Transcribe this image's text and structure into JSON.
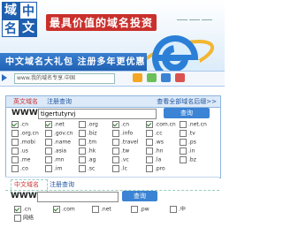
{
  "colors": {
    "accent": "#2c6cc0",
    "brand_red": "#c9302c",
    "panel_border": "#8eb5df"
  },
  "logo": {
    "chars": [
      "域",
      "名",
      "中",
      "文"
    ]
  },
  "banner": {
    "tagline": "最具价值的域名投资",
    "gift_text": "中文域名大礼包  注册多年更优惠"
  },
  "search_strip": {
    "placeholder": "www.我的域名专享.中国"
  },
  "panel": {
    "tab_en": "英文域名",
    "tab_reg": "注册查询",
    "right_link": "查看全部域名后缀>>",
    "www_label": "WWW.",
    "domain_value": "tigertutyrvj",
    "query_button": "查询",
    "extensions": [
      [
        {
          "label": ".cn",
          "checked": true
        },
        {
          "label": ".net",
          "checked": true
        },
        {
          "label": ".org",
          "checked": false
        },
        {
          "label": ".cn",
          "checked": true
        },
        {
          "label": ".com.cn",
          "checked": true
        },
        {
          "label": ".net.cn",
          "checked": false
        }
      ],
      [
        {
          "label": ".org.cn",
          "checked": false
        },
        {
          "label": ".gov.cn",
          "checked": false
        },
        {
          "label": ".biz",
          "checked": false
        },
        {
          "label": ".info",
          "checked": false
        },
        {
          "label": ".cc",
          "checked": false
        },
        {
          "label": ".tv",
          "checked": false
        }
      ],
      [
        {
          "label": ".mobi",
          "checked": false
        },
        {
          "label": ".name",
          "checked": false
        },
        {
          "label": ".tm",
          "checked": false
        },
        {
          "label": ".travel",
          "checked": false
        },
        {
          "label": ".ws",
          "checked": false
        },
        {
          "label": ".ps",
          "checked": false
        }
      ],
      [
        {
          "label": ".us",
          "checked": false
        },
        {
          "label": ".asia",
          "checked": false
        },
        {
          "label": ".hk",
          "checked": false
        },
        {
          "label": ".tw",
          "checked": false
        },
        {
          "label": ".hn",
          "checked": false
        },
        {
          "label": ".in",
          "checked": false
        }
      ],
      [
        {
          "label": ".me",
          "checked": false
        },
        {
          "label": ".mn",
          "checked": false
        },
        {
          "label": ".ag",
          "checked": false
        },
        {
          "label": ".vc",
          "checked": false
        },
        {
          "label": ".la",
          "checked": false
        },
        {
          "label": ".bz",
          "checked": false
        }
      ],
      [
        {
          "label": ".co",
          "checked": false
        },
        {
          "label": ".im",
          "checked": false
        },
        {
          "label": ".sc",
          "checked": false
        },
        {
          "label": ".lc",
          "checked": false
        },
        {
          "label": ".pro",
          "checked": false
        },
        {
          "label": "",
          "checked": false
        }
      ]
    ]
  },
  "panel2": {
    "tab_cn": "中文域名",
    "tab_reg": "注册查询",
    "www_label": "WWW.",
    "query_button": "查询",
    "extensions": [
      [
        {
          "label": ".cn",
          "checked": true
        },
        {
          "label": ".com",
          "checked": true
        },
        {
          "label": ".net",
          "checked": false
        },
        {
          "label": ".pw",
          "checked": false
        },
        {
          "label": ".中",
          "checked": false
        }
      ],
      [
        {
          "label": "网络",
          "checked": false
        }
      ]
    ]
  },
  "icons": [
    "arrow-right-icon",
    "help-icon",
    "user-icon",
    "cart-icon",
    "mail-icon"
  ]
}
